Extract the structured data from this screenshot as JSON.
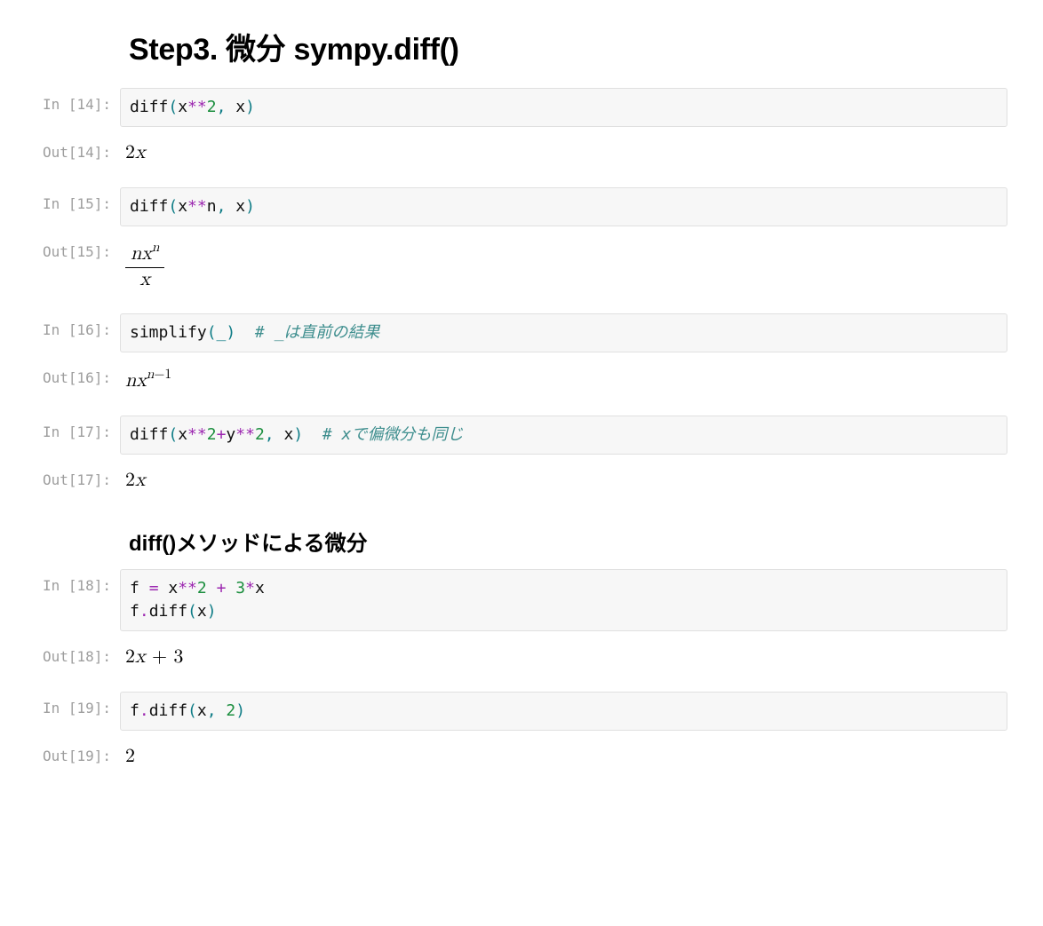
{
  "heading": "Step3. 微分 sympy.diff()",
  "subheading": "diff()メソッドによる微分",
  "prompts": {
    "in14": "In [14]:",
    "out14": "Out[14]:",
    "in15": "In [15]:",
    "out15": "Out[15]:",
    "in16": "In [16]:",
    "out16": "Out[16]:",
    "in17": "In [17]:",
    "out17": "Out[17]:",
    "in18": "In [18]:",
    "out18": "Out[18]:",
    "in19": "In [19]:",
    "out19": "Out[19]:"
  },
  "code14": {
    "fn": "diff",
    "lp": "(",
    "v1": "x",
    "op1": "**",
    "n1": "2",
    "c": ", ",
    "v2": "x",
    "rp": ")"
  },
  "out14_math": {
    "coef": "2",
    "var": "x"
  },
  "code15": {
    "fn": "diff",
    "lp": "(",
    "v1": "x",
    "op1": "**",
    "v2": "n",
    "c": ", ",
    "v3": "x",
    "rp": ")"
  },
  "out15_math": {
    "num_n": "n",
    "num_x": "x",
    "num_sup": "n",
    "den": "x"
  },
  "code16": {
    "fn": "simplify",
    "lp": "(",
    "under": "_",
    "rp": ")",
    "sp": "  ",
    "comment": "# _は直前の結果"
  },
  "out16_math": {
    "n": "n",
    "x": "x",
    "sup1": "n",
    "minus": "−",
    "one": "1"
  },
  "code17": {
    "fn": "diff",
    "lp": "(",
    "v1": "x",
    "op1": "**",
    "n1": "2",
    "plus": "+",
    "v2": "y",
    "op2": "**",
    "n2": "2",
    "c": ", ",
    "v3": "x",
    "rp": ")",
    "sp": "  ",
    "comment": "# xで偏微分も同じ"
  },
  "out17_math": {
    "coef": "2",
    "var": "x"
  },
  "code18": {
    "l1": {
      "v1": "f",
      "sp1": " ",
      "eq": "=",
      "sp2": " ",
      "v2": "x",
      "op1": "**",
      "n1": "2",
      "sp3": " ",
      "plus": "+",
      "sp4": " ",
      "n2": "3",
      "op2": "*",
      "v3": "x"
    },
    "l2": {
      "v1": "f",
      "dot": ".",
      "fn": "diff",
      "lp": "(",
      "v2": "x",
      "rp": ")"
    }
  },
  "out18_math": {
    "two": "2",
    "x": "x",
    "sp": " ",
    "plus": "+",
    "sp2": " ",
    "three": "3"
  },
  "code19": {
    "v1": "f",
    "dot": ".",
    "fn": "diff",
    "lp": "(",
    "v2": "x",
    "c": ", ",
    "n": "2",
    "rp": ")"
  },
  "out19_math": {
    "two": "2"
  }
}
